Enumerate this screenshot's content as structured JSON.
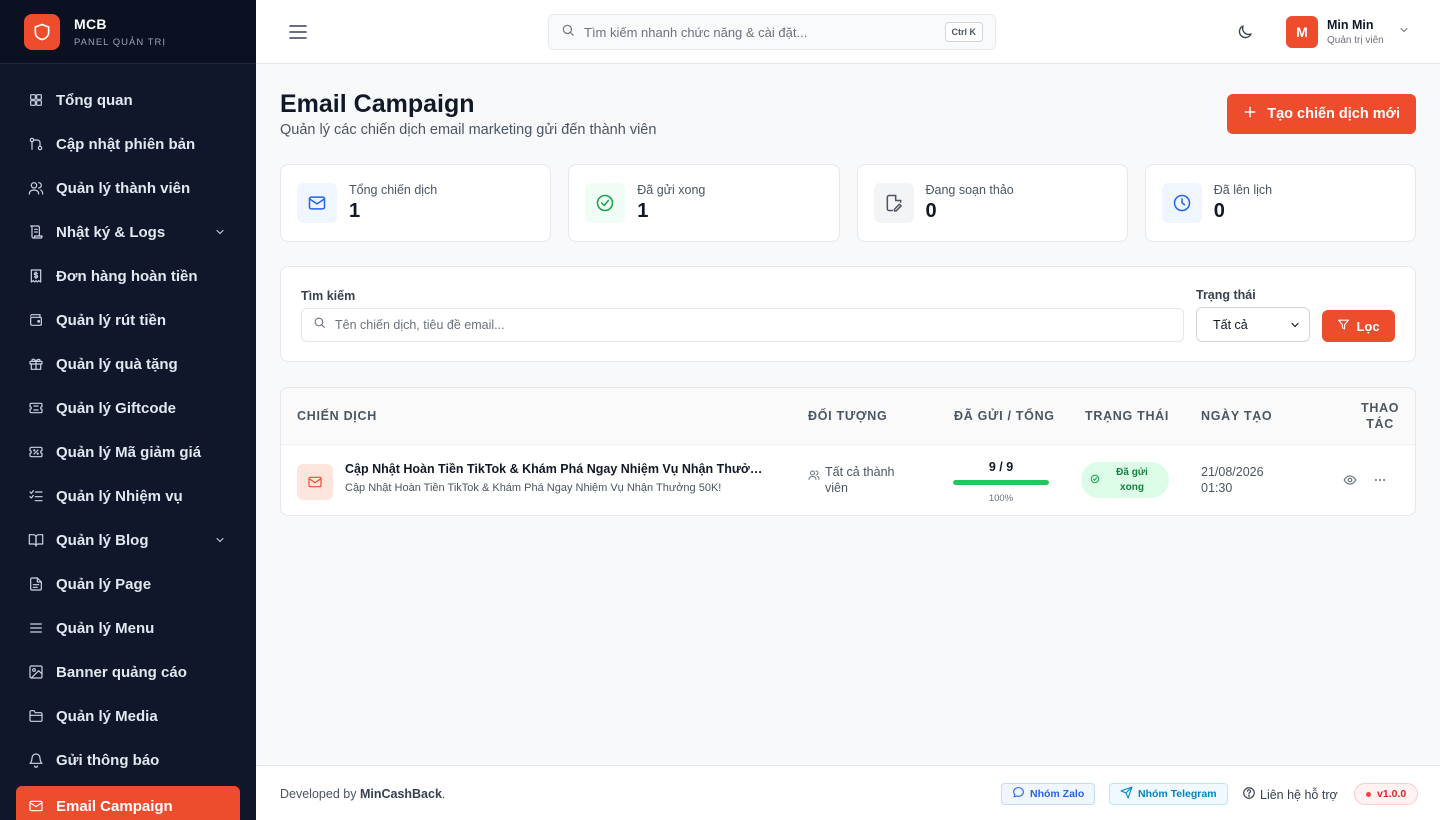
{
  "brand": {
    "name": "MCB",
    "subtitle": "PANEL QUẢN TRỊ"
  },
  "sidebar": {
    "items": [
      {
        "label": "Tổng quan",
        "icon": "dashboard-icon"
      },
      {
        "label": "Cập nhật phiên bản",
        "icon": "git-icon"
      },
      {
        "label": "Quản lý thành viên",
        "icon": "users-icon"
      },
      {
        "label": "Nhật ký & Logs",
        "icon": "scroll-icon",
        "expandable": true
      },
      {
        "label": "Đơn hàng hoàn tiền",
        "icon": "receipt-dollar-icon"
      },
      {
        "label": "Quản lý rút tiền",
        "icon": "wallet-icon"
      },
      {
        "label": "Quản lý quà tặng",
        "icon": "gift-icon"
      },
      {
        "label": "Quản lý Giftcode",
        "icon": "ticket-icon"
      },
      {
        "label": "Quản lý Mã giảm giá",
        "icon": "coupon-icon"
      },
      {
        "label": "Quản lý Nhiệm vụ",
        "icon": "checklist-icon"
      },
      {
        "label": "Quản lý Blog",
        "icon": "book-icon",
        "expandable": true
      },
      {
        "label": "Quản lý Page",
        "icon": "file-icon"
      },
      {
        "label": "Quản lý Menu",
        "icon": "menu-icon"
      },
      {
        "label": "Banner quảng cáo",
        "icon": "image-icon"
      },
      {
        "label": "Quản lý Media",
        "icon": "folder-icon"
      },
      {
        "label": "Gửi thông báo",
        "icon": "bell-icon"
      },
      {
        "label": "Email Campaign",
        "icon": "mail-icon",
        "active": true
      }
    ]
  },
  "topbar": {
    "search_placeholder": "Tìm kiếm nhanh chức năng & cài đặt...",
    "shortcut": "Ctrl K",
    "user": {
      "initial": "M",
      "name": "Min Min",
      "role": "Quản trị viên"
    }
  },
  "page": {
    "title": "Email Campaign",
    "subtitle": "Quản lý các chiến dịch email marketing gửi đến thành viên",
    "create_button": "Tạo chiến dịch mới"
  },
  "stats": [
    {
      "label": "Tổng chiến dịch",
      "value": "1",
      "icon": "mail-icon",
      "color": "#2563eb",
      "bg": "#eff6ff"
    },
    {
      "label": "Đã gửi xong",
      "value": "1",
      "icon": "check-circle-icon",
      "color": "#16a34a",
      "bg": "#f0fdf4"
    },
    {
      "label": "Đang soạn thảo",
      "value": "0",
      "icon": "file-edit-icon",
      "color": "#4b5563",
      "bg": "#f3f4f6"
    },
    {
      "label": "Đã lên lịch",
      "value": "0",
      "icon": "clock-icon",
      "color": "#2563eb",
      "bg": "#eff6ff"
    }
  ],
  "filter": {
    "search_label": "Tìm kiếm",
    "search_placeholder": "Tên chiến dịch, tiêu đề email...",
    "status_label": "Trạng thái",
    "status_value": "Tất cả",
    "filter_button": "Lọc"
  },
  "table": {
    "headers": {
      "campaign": "CHIẾN DỊCH",
      "audience": "ĐỐI TƯỢNG",
      "sent": "ĐÃ GỬI / TỔNG",
      "status": "TRẠNG THÁI",
      "created": "NGÀY TẠO",
      "actions_1": "THAO",
      "actions_2": "TÁC"
    },
    "rows": [
      {
        "title": "Cập Nhật Hoàn Tiền TikTok & Khám Phá Ngay Nhiệm Vụ Nhận Thưởng 50K!",
        "subject": "Cập Nhật Hoàn Tiền TikTok & Khám Phá Ngay Nhiệm Vụ Nhận Thưởng 50K!",
        "audience": "Tất cả thành viên",
        "sent_text": "9 / 9",
        "progress": 1.0,
        "percent": "100%",
        "status": "Đã gửi xong",
        "created_date": "21/08/2026",
        "created_time": "01:30"
      }
    ]
  },
  "footer": {
    "developed_prefix": "Developed by",
    "developer": "MinCashBack",
    "developed_suffix": ".",
    "zalo": "Nhóm Zalo",
    "telegram": "Nhóm Telegram",
    "support": "Liên hệ hỗ trợ",
    "version": "v1.0.0"
  },
  "colors": {
    "accent": "#ee4d2d",
    "sidebar_bg": "#0f172a",
    "success": "#22c55e"
  }
}
